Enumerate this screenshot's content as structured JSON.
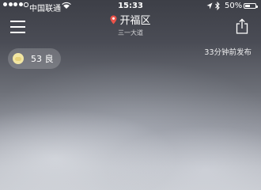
{
  "status_bar": {
    "carrier": "中国联通",
    "time": "15:33",
    "battery_percent": "50%",
    "battery_level": 0.5,
    "icons": [
      "signal-dots-icon",
      "wifi-icon",
      "location-arrow-icon",
      "bluetooth-icon",
      "battery-icon"
    ]
  },
  "header": {
    "city": "开福区",
    "district": "三一大道",
    "icons": [
      "menu-icon",
      "location-pin-icon",
      "share-icon"
    ],
    "accent_color": "#e8534a"
  },
  "aqi": {
    "text": "53 良",
    "icon": "air-quality-icon",
    "color": "#f2e6a3"
  },
  "publish": {
    "text": "33分钟前发布"
  }
}
